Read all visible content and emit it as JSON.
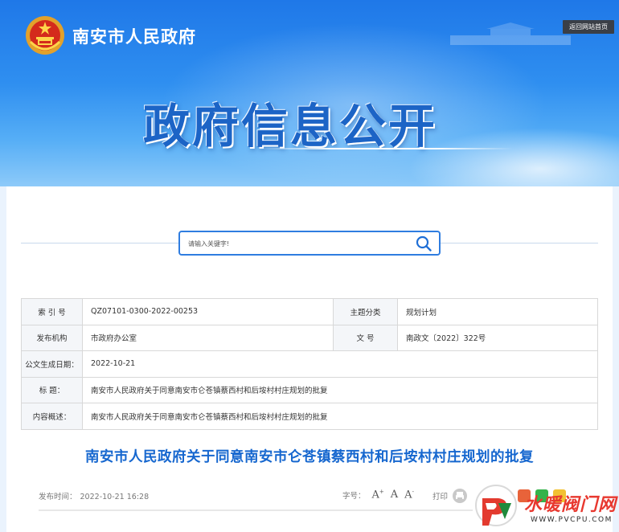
{
  "header": {
    "site_name": "南安市人民政府",
    "back_home": "返回网站首页",
    "banner_title": "政府信息公开"
  },
  "search": {
    "placeholder": "请输入关键字!"
  },
  "meta": {
    "rows": [
      {
        "label": "索 引 号",
        "value": "QZ07101-0300-2022-00253",
        "label2": "主题分类",
        "value2": "规划计划"
      },
      {
        "label": "发布机构",
        "value": "市政府办公室",
        "label2": "文 号",
        "value2": "南政文〔2022〕322号"
      },
      {
        "label": "公文生成日期：",
        "value": "2022-10-21"
      },
      {
        "label": "标 题：",
        "value": "南安市人民政府关于同意南安市仑苍镇蔡西村和后垵村村庄规划的批复"
      },
      {
        "label": "内容概述：",
        "value": "南安市人民政府关于同意南安市仑苍镇蔡西村和后垵村村庄规划的批复"
      }
    ]
  },
  "article": {
    "title": "南安市人民政府关于同意南安市仑苍镇蔡西村和后垵村村庄规划的批复",
    "pub_label": "发布时间：",
    "pub_time": "2022-10-21 16:28",
    "font_label": "字号：",
    "font_large": "A",
    "font_medium": "A",
    "font_small": "A",
    "print_label": "打印"
  },
  "watermark": {
    "text": "水暖阀门网",
    "url": "WWW.PVCPU.COM"
  },
  "colors": {
    "accent": "#1667cf",
    "search_border": "#2f7de0",
    "watermark_red": "#e8382f"
  }
}
